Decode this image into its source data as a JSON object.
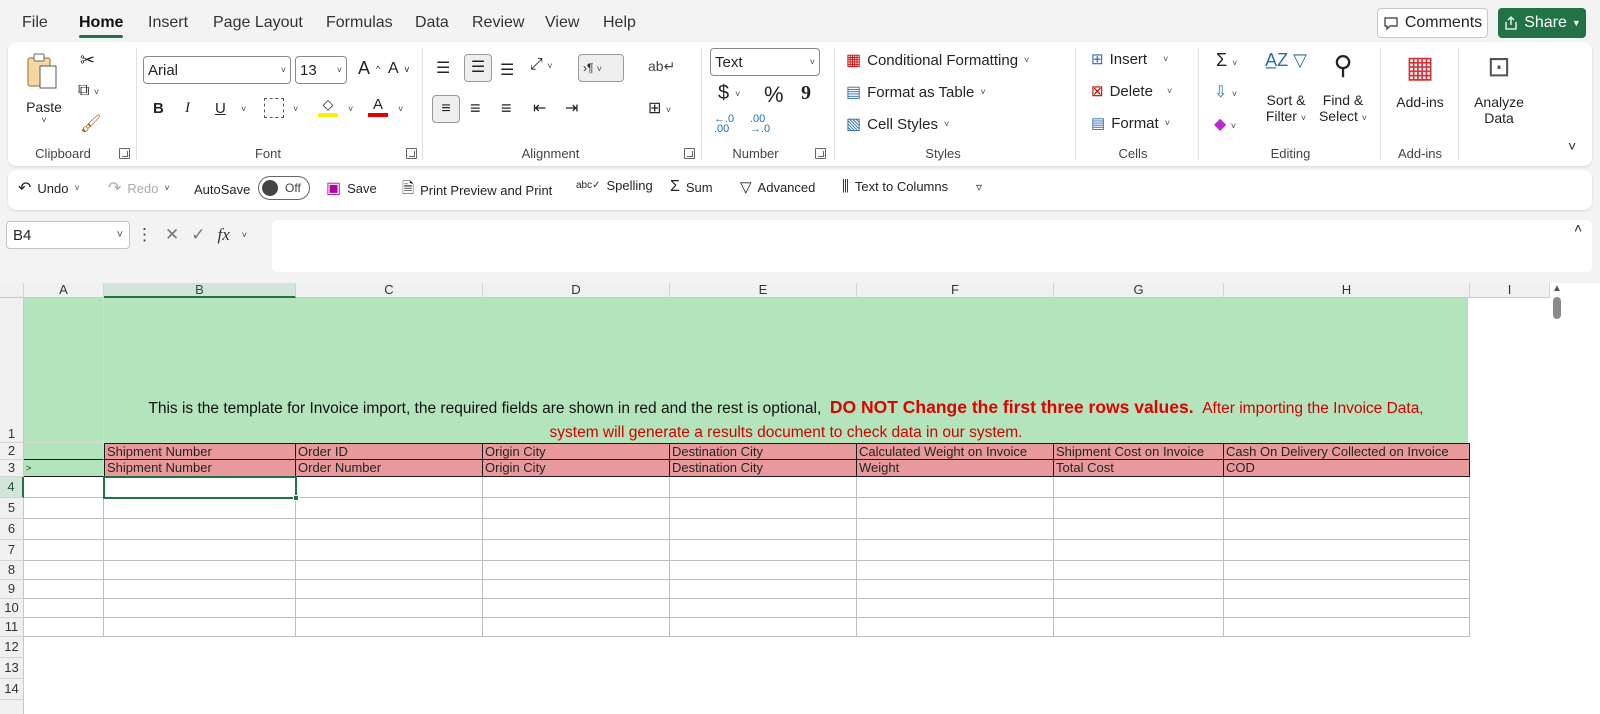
{
  "menu": {
    "items": [
      "File",
      "Home",
      "Insert",
      "Page Layout",
      "Formulas",
      "Data",
      "Review",
      "View",
      "Help"
    ],
    "active": "Home",
    "comments_label": "Comments",
    "share_label": "Share"
  },
  "ribbon": {
    "clipboard": {
      "paste_label": "Paste",
      "group_label": "Clipboard"
    },
    "font": {
      "family": "Arial",
      "size": "13",
      "bold": "B",
      "italic": "I",
      "underline": "U",
      "group_label": "Font"
    },
    "alignment": {
      "group_label": "Alignment"
    },
    "number": {
      "format": "Text",
      "currency": "$",
      "percent": "%",
      "comma": "9",
      "group_label": "Number"
    },
    "styles": {
      "conditional": "Conditional Formatting",
      "format_table": "Format as Table",
      "cell_styles": "Cell Styles",
      "group_label": "Styles"
    },
    "cells": {
      "insert": "Insert",
      "delete": "Delete",
      "format": "Format",
      "group_label": "Cells"
    },
    "editing": {
      "sort_line1": "Sort &",
      "sort_line2": "Filter",
      "find_line1": "Find &",
      "find_line2": "Select",
      "group_label": "Editing"
    },
    "addins": {
      "label": "Add-ins",
      "group_label": "Add-ins"
    },
    "analyze": {
      "line1": "Analyze",
      "line2": "Data"
    }
  },
  "qat": {
    "undo": "Undo",
    "redo": "Redo",
    "autosave": "AutoSave",
    "autosave_state": "Off",
    "save": "Save",
    "print_preview": "Print Preview and Print",
    "spelling": "Spelling",
    "sum": "Sum",
    "advanced": "Advanced",
    "text_to_columns": "Text to Columns"
  },
  "formula_bar": {
    "name_box": "B4",
    "fx": "fx",
    "content": ""
  },
  "sheet": {
    "columns": [
      "A",
      "B",
      "C",
      "D",
      "E",
      "F",
      "G",
      "H",
      "I"
    ],
    "selected_column": "B",
    "rows": [
      "1",
      "2",
      "3",
      "4",
      "5",
      "6",
      "7",
      "8",
      "9",
      "10",
      "11",
      "12",
      "13",
      "14"
    ],
    "selected_row": "4",
    "banner_text_1": "This is the template for Invoice import, the required fields are shown in red and the rest is optional,",
    "banner_warning": "DO NOT Change the first three rows values.",
    "banner_text_2": "After importing the Invoice Data,",
    "banner_text_3": "system will generate a results document to check data in our system.",
    "row2": [
      "Shipment Number",
      "Order ID",
      "Origin City",
      "Destination City",
      "Calculated Weight on Invoice",
      "Shipment Cost on Invoice",
      "Cash On Delivery Collected on Invoice"
    ],
    "row3": [
      "Shipment Number",
      "Order Number",
      "Origin City",
      "Destination City",
      "Weight",
      "Total Cost",
      "COD"
    ],
    "row3_a": ">"
  },
  "colors": {
    "accent": "#217346",
    "header_green": "#b4e4bc",
    "required_red": "#e8999b",
    "warning_red": "#e00000"
  }
}
